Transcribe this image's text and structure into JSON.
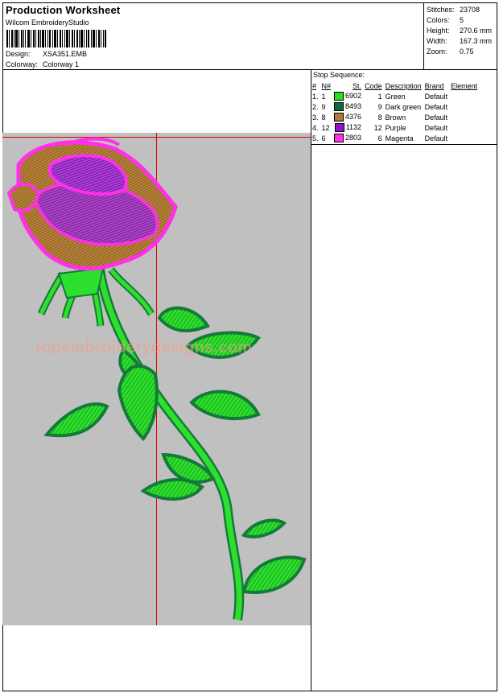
{
  "header": {
    "title": "Production Worksheet",
    "software": "Wilcom EmbroideryStudio",
    "design_label": "Design:",
    "design_value": "XSA351.EMB",
    "colorway_label": "Colorway:",
    "colorway_value": "Colorway 1"
  },
  "stats": {
    "stitches_label": "Stitches:",
    "stitches": "23708",
    "colors_label": "Colors:",
    "colors": "5",
    "height_label": "Height:",
    "height": "270.6 mm",
    "width_label": "Width:",
    "width": "167.3 mm",
    "zoom_label": "Zoom:",
    "zoom": "0.75"
  },
  "stop_sequence": {
    "title": "Stop Sequence:",
    "headers": [
      "#",
      "N#",
      "St.",
      "Code",
      "Description",
      "Brand",
      "Element"
    ],
    "rows": [
      {
        "num": "1.",
        "n": "1",
        "color": "#22e022",
        "st": "6902",
        "code": "1",
        "description": "Green",
        "brand": "Default"
      },
      {
        "num": "2.",
        "n": "9",
        "color": "#0e6a3a",
        "st": "8493",
        "code": "9",
        "description": "Dark green",
        "brand": "Default"
      },
      {
        "num": "3.",
        "n": "8",
        "color": "#b07838",
        "st": "4376",
        "code": "8",
        "description": "Brown",
        "brand": "Default"
      },
      {
        "num": "4.",
        "n": "12",
        "color": "#8a18c8",
        "st": "1132",
        "code": "12",
        "description": "Purple",
        "brand": "Default"
      },
      {
        "num": "5.",
        "n": "6",
        "color": "#ff30e8",
        "st": "2803",
        "code": "6",
        "description": "Magenta",
        "brand": "Default"
      }
    ]
  },
  "watermark": "topembroiderydesigns.com"
}
